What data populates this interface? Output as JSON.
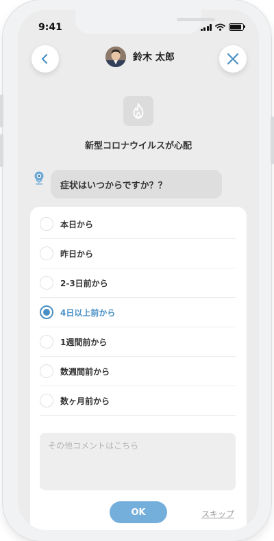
{
  "status_bar": {
    "time": "9:41"
  },
  "header": {
    "user_name": "鈴木 太郎",
    "back_icon": "chevron-left-icon",
    "close_icon": "close-icon"
  },
  "topic": {
    "icon": "flame-icon",
    "title": "新型コロナウイルスが心配"
  },
  "question": {
    "text": "症状はいつからですか？？"
  },
  "options": [
    {
      "label": "本日から",
      "selected": false
    },
    {
      "label": "昨日から",
      "selected": false
    },
    {
      "label": "2-3日前から",
      "selected": false
    },
    {
      "label": "4日以上前から",
      "selected": true
    },
    {
      "label": "1週間前から",
      "selected": false
    },
    {
      "label": "数週間前から",
      "selected": false
    },
    {
      "label": "数ヶ月前から",
      "selected": false
    }
  ],
  "comment": {
    "placeholder": "その他コメントはこちら",
    "value": ""
  },
  "actions": {
    "ok_label": "OK",
    "skip_label": "スキップ"
  },
  "colors": {
    "accent": "#4a90c4",
    "ok_button": "#74aedb",
    "background": "#ececec"
  }
}
